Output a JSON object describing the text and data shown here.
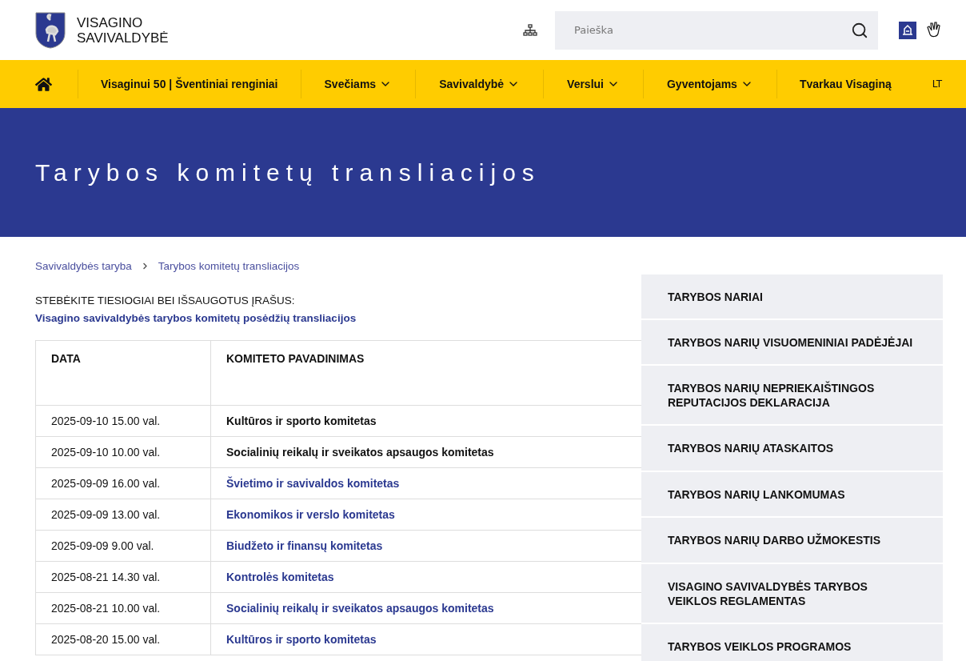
{
  "header": {
    "logo_line1": "VISAGINO",
    "logo_line2": "SAVIVALDYBĖ",
    "search": {
      "placeholder": "Paieška"
    }
  },
  "nav": {
    "items": [
      {
        "label": "Visaginui 50 | Šventiniai renginiai",
        "dropdown": false
      },
      {
        "label": "Svečiams",
        "dropdown": true
      },
      {
        "label": "Savivaldybė",
        "dropdown": true
      },
      {
        "label": "Verslui",
        "dropdown": true
      },
      {
        "label": "Gyventojams",
        "dropdown": true
      },
      {
        "label": "Tvarkau Visaginą",
        "dropdown": false
      }
    ],
    "languages": [
      {
        "label": "LT",
        "selected": true
      }
    ]
  },
  "banner": {
    "title": "Tarybos komitetų transliacijos"
  },
  "breadcrumb": [
    "Savivaldybės taryba",
    "Tarybos komitetų transliacijos"
  ],
  "intro": {
    "text": "STEBĖKITE TIESIOGIAI BEI IŠSAUGOTUS ĮRAŠUS:",
    "link": "Visagino savivaldybės tarybos komitetų posėdžių transliacijos"
  },
  "table": {
    "columns": [
      "DATA",
      "KOMITETO PAVADINIMAS"
    ],
    "rows": [
      {
        "date": "2025-09-10 15.00 val.",
        "name": "Kultūros ir sporto komitetas",
        "kind": "text"
      },
      {
        "date": "2025-09-10 10.00 val.",
        "name": "Socialinių reikalų ir sveikatos apsaugos komitetas",
        "kind": "text"
      },
      {
        "date": "2025-09-09 16.00 val.",
        "name": "Švietimo ir savivaldos komitetas",
        "kind": "link"
      },
      {
        "date": "2025-09-09 13.00 val.",
        "name": "Ekonomikos ir verslo komitetas",
        "kind": "link"
      },
      {
        "date": "2025-09-09 9.00 val.",
        "name": "Biudžeto ir finansų komitetas",
        "kind": "link"
      },
      {
        "date": "2025-08-21 14.30 val.",
        "name": "Kontrolės komitetas",
        "kind": "link"
      },
      {
        "date": "2025-08-21 10.00 val.",
        "name": "Socialinių reikalų ir sveikatos apsaugos komitetas",
        "kind": "link"
      },
      {
        "date": "2025-08-20 15.00 val.",
        "name": "Kultūros ir sporto komitetas",
        "kind": "link"
      }
    ]
  },
  "sidebar": {
    "items": [
      "TARYBOS NARIAI",
      "TARYBOS NARIŲ VISUOMENINIAI PADĖJĖJAI",
      "TARYBOS NARIŲ NEPRIEKAIŠTINGOS REPUTACIJOS DEKLARACIJA",
      "TARYBOS NARIŲ ATASKAITOS",
      "TARYBOS NARIŲ LANKOMUMAS",
      "TARYBOS NARIŲ DARBO UŽMOKESTIS",
      "VISAGINO SAVIVALDYBĖS TARYBOS VEIKLOS REGLAMENTAS",
      "TARYBOS VEIKLOS PROGRAMOS"
    ]
  }
}
